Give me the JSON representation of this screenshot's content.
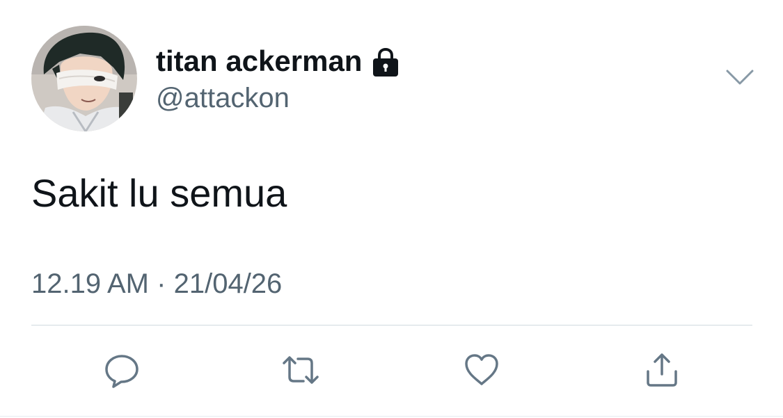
{
  "tweet": {
    "author": {
      "display_name": "titan ackerman",
      "handle": "@attackon",
      "protected": true,
      "avatar": "anime-character-portrait"
    },
    "text": "Sakit lu semua",
    "time": "12.19 AM",
    "separator": "·",
    "date": "21/04/26"
  },
  "icons": {
    "lock": "lock-icon",
    "menu": "chevron-down-icon",
    "reply": "reply-icon",
    "retweet": "retweet-icon",
    "like": "heart-icon",
    "share": "share-icon"
  },
  "colors": {
    "text_primary": "#0f1419",
    "text_secondary": "#536471",
    "icon_gray": "#657786",
    "divider": "#cfd9de",
    "background": "#ffffff"
  }
}
